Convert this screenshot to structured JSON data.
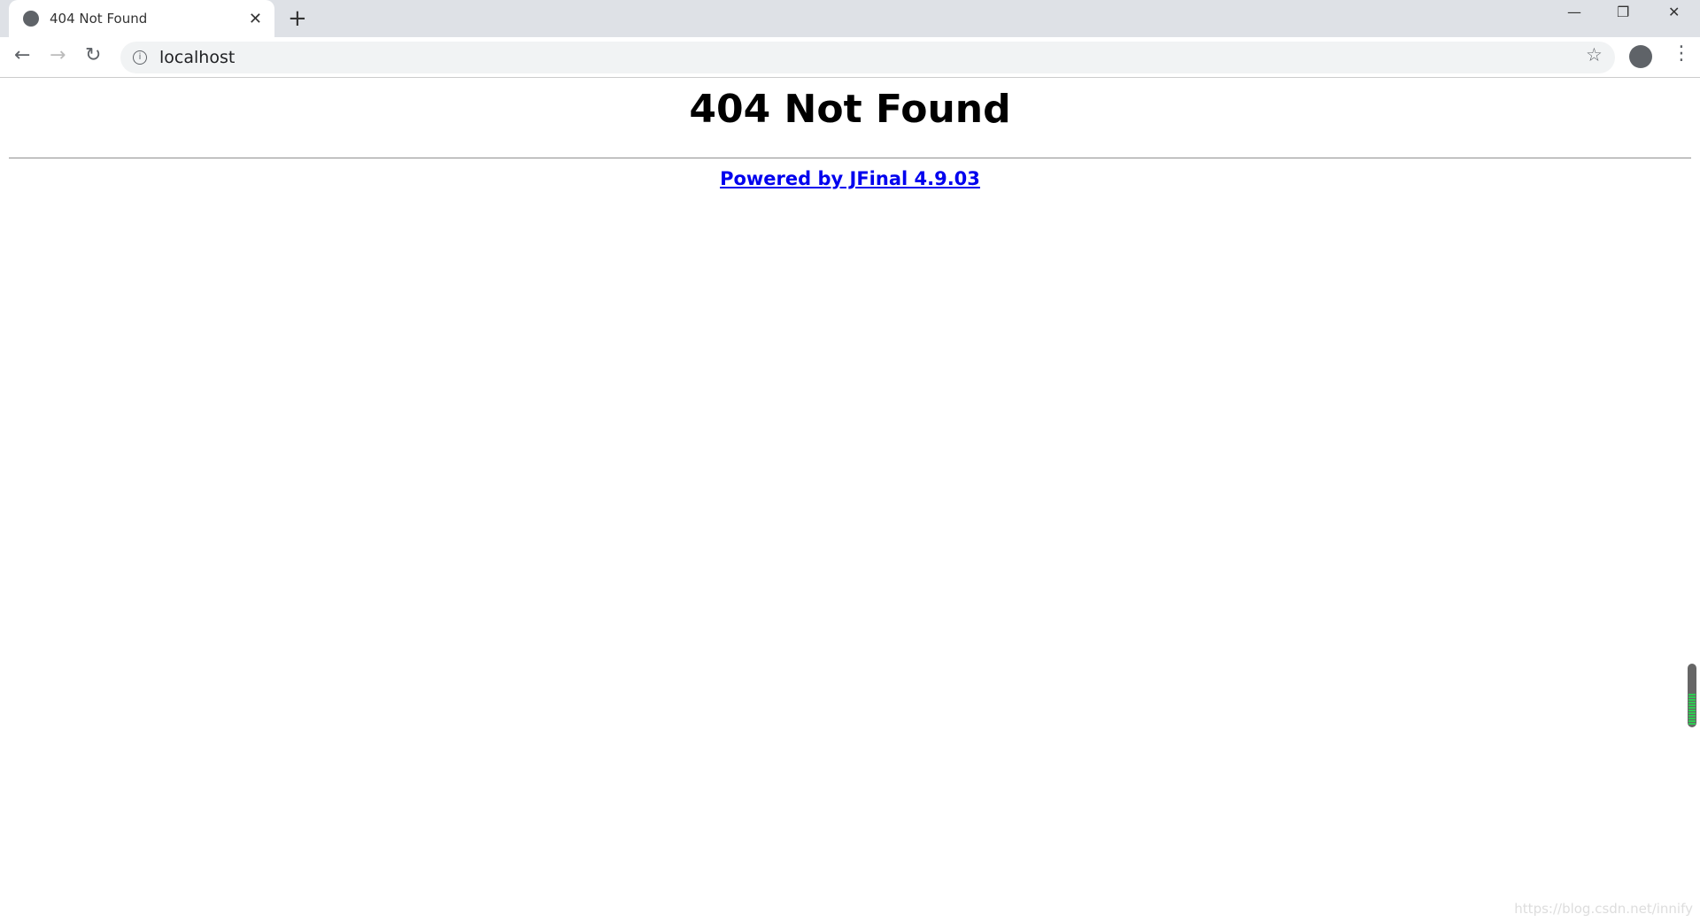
{
  "browser": {
    "tab_title": "404 Not Found",
    "url": "localhost"
  },
  "page": {
    "heading": "404 Not Found",
    "link_text": "Powered by JFinal 4.9.03"
  },
  "widget": {
    "level_percent": 50,
    "color": "#2ecc52"
  },
  "watermark": "https://blog.csdn.net/innify"
}
